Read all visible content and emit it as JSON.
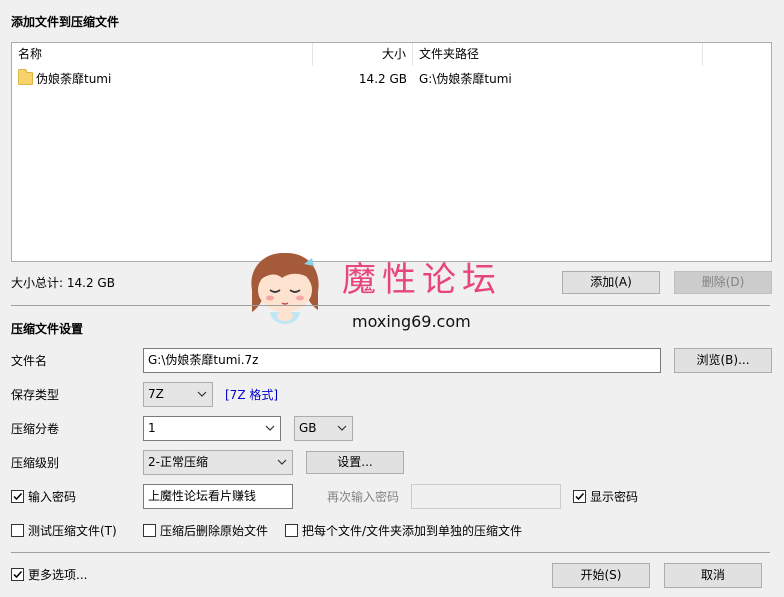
{
  "files_section": {
    "title": "添加文件到压缩文件",
    "columns": [
      "名称",
      "大小",
      "文件夹路径"
    ],
    "rows": [
      {
        "name": "伪娘荼靡tumi",
        "size": "14.2 GB",
        "path": "G:\\伪娘荼靡tumi"
      }
    ],
    "total_label": "大小总计: 14.2 GB",
    "add_button": "添加(A)",
    "delete_button": "删除(D)"
  },
  "watermark": {
    "title": "魔性论坛",
    "domain": "moxing69.com"
  },
  "settings": {
    "title": "压缩文件设置",
    "filename_label": "文件名",
    "filename_value": "G:\\伪娘荼靡tumi.7z",
    "browse_button": "浏览(B)...",
    "type_label": "保存类型",
    "type_value": "7Z",
    "format_link": "[7Z 格式]",
    "volume_label": "压缩分卷",
    "volume_value": "1",
    "volume_unit": "GB",
    "level_label": "压缩级别",
    "level_value": "2-正常压缩",
    "settings_button": "设置...",
    "password_label": "输入密码",
    "password_value": "上魔性论坛看片赚钱",
    "password_checked": true,
    "confirm_label": "再次输入密码",
    "confirm_value": "",
    "show_password_label": "显示密码",
    "show_password_checked": true,
    "test_label": "测试压缩文件(T)",
    "test_checked": false,
    "delete_source_label": "压缩后删除原始文件",
    "delete_source_checked": false,
    "separate_label": "把每个文件/文件夹添加到单独的压缩文件",
    "separate_checked": false
  },
  "footer": {
    "more_options_label": "更多选项...",
    "more_options_checked": true,
    "start_button": "开始(S)",
    "cancel_button": "取消"
  },
  "colors": {
    "watermark_text": "#e8457a",
    "link": "#0000cc"
  }
}
